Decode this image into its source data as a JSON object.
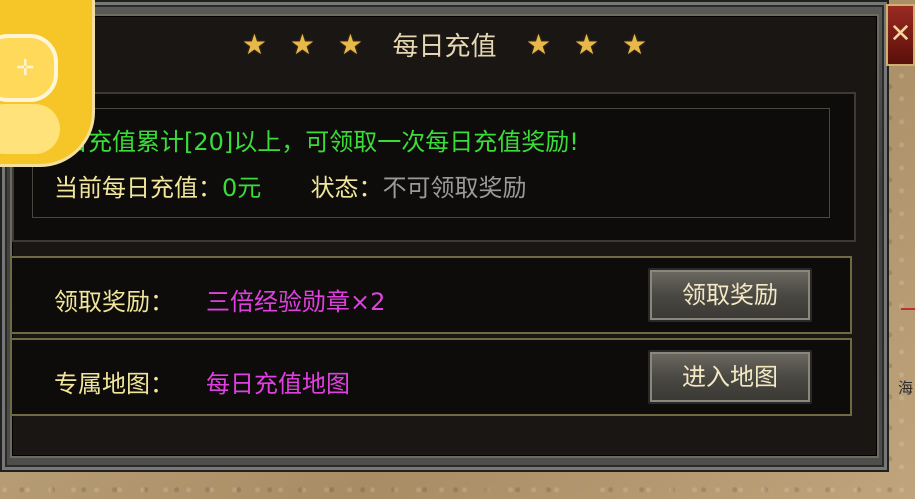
{
  "window": {
    "title": "每日充值",
    "close_glyph": "✕",
    "stars_left": [
      "★",
      "★",
      "★"
    ],
    "stars_right": [
      "★",
      "★",
      "★"
    ]
  },
  "info": {
    "requirement": "每日充值累计[20]以上，可领取一次每日充值奖励!",
    "current_label": "当前每日充值：",
    "current_value": "0元",
    "status_label": "状态：",
    "status_value": "不可领取奖励"
  },
  "reward_row": {
    "label": "领取奖励：",
    "value": "三倍经验勋章×2",
    "button": "领取奖励"
  },
  "map_row": {
    "label": "专属地图：",
    "value": "每日充值地图",
    "button": "进入地图"
  },
  "background": {
    "map_text": "海"
  },
  "colors": {
    "green": "#3adc3a",
    "magenta": "#e040e0",
    "yellow_label": "#f1e69a",
    "gold_star": "#e8b84a"
  },
  "icons": [
    "star-icon",
    "close-icon",
    "game-app-icon"
  ]
}
